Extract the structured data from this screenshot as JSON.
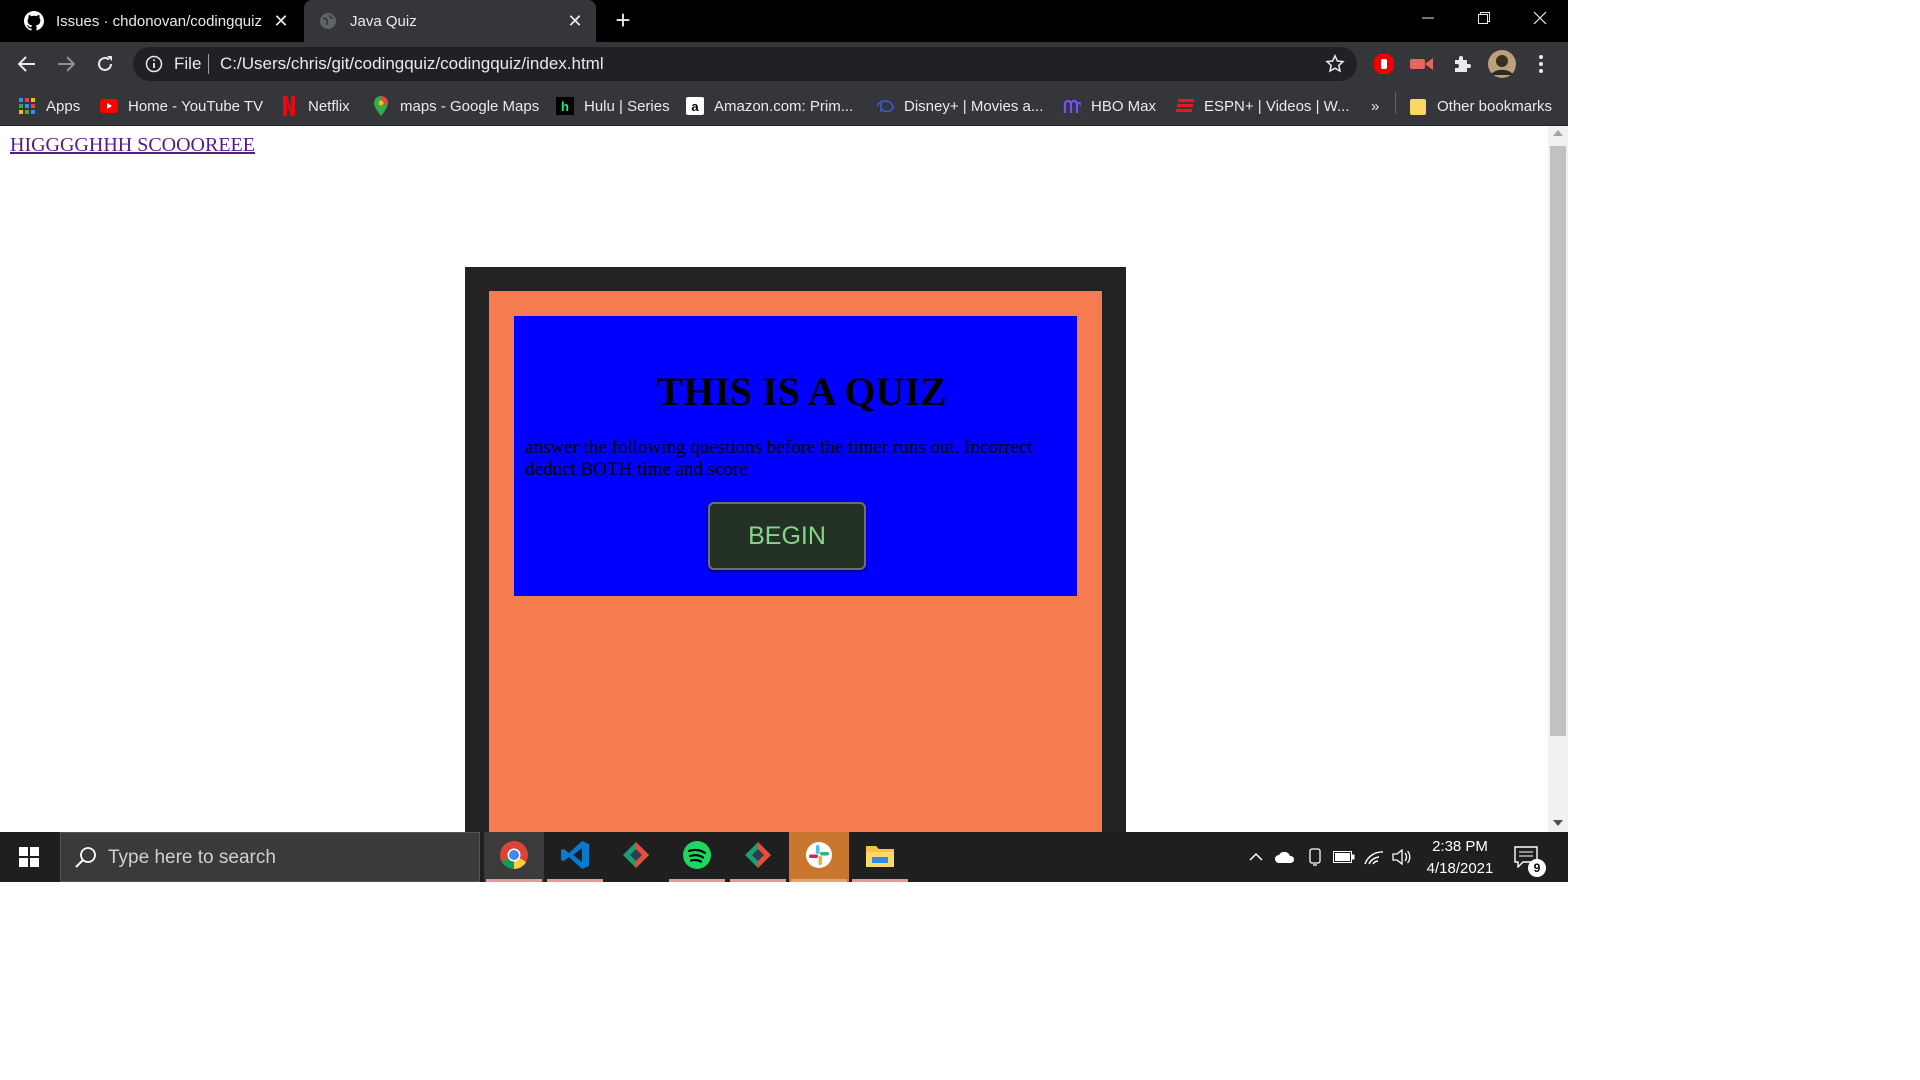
{
  "browser": {
    "tabs": [
      {
        "title": "Issues · chdonovan/codingquiz",
        "icon": "github-icon",
        "active": false
      },
      {
        "title": "Java Quiz",
        "icon": "globe-icon",
        "active": true
      }
    ],
    "address": {
      "scheme_label": "File",
      "url": "C:/Users/chris/git/codingquiz/codingquiz/index.html"
    },
    "bookmarks": [
      {
        "label": "Apps",
        "icon": "apps-grid-icon"
      },
      {
        "label": "Home - YouTube TV",
        "icon": "youtube-icon"
      },
      {
        "label": "Netflix",
        "icon": "netflix-icon"
      },
      {
        "label": "maps - Google Maps",
        "icon": "google-maps-icon"
      },
      {
        "label": "Hulu | Series",
        "icon": "hulu-icon"
      },
      {
        "label": "Amazon.com: Prim...",
        "icon": "amazon-icon"
      },
      {
        "label": "Disney+ | Movies a...",
        "icon": "disney-plus-icon"
      },
      {
        "label": "HBO Max",
        "icon": "hbo-max-icon"
      },
      {
        "label": "ESPN+ | Videos | W...",
        "icon": "espn-icon"
      }
    ],
    "overflow_label": "»",
    "other_bookmarks": "Other bookmarks"
  },
  "page": {
    "highscore_link": "HIGGGGHHH SCOOOREEE",
    "title": "THIS IS A QUIZ",
    "description": "answer the following questions before the timer runs out. Incorrect deduct BOTH time and score",
    "begin_label": "BEGIN"
  },
  "taskbar": {
    "search_placeholder": "Type here to search",
    "time": "2:38 PM",
    "date": "4/18/2021",
    "notification_count": "9",
    "apps": [
      "chrome-icon",
      "vscode-icon",
      "git-kraken-icon",
      "spotify-icon",
      "git-kraken-icon",
      "slack-icon",
      "file-explorer-icon"
    ]
  },
  "colors": {
    "page_frame": "#222222",
    "orange_panel": "#f57c4e",
    "blue_panel": "#0000ff",
    "button_bg": "#243225",
    "button_text": "#86d686"
  }
}
